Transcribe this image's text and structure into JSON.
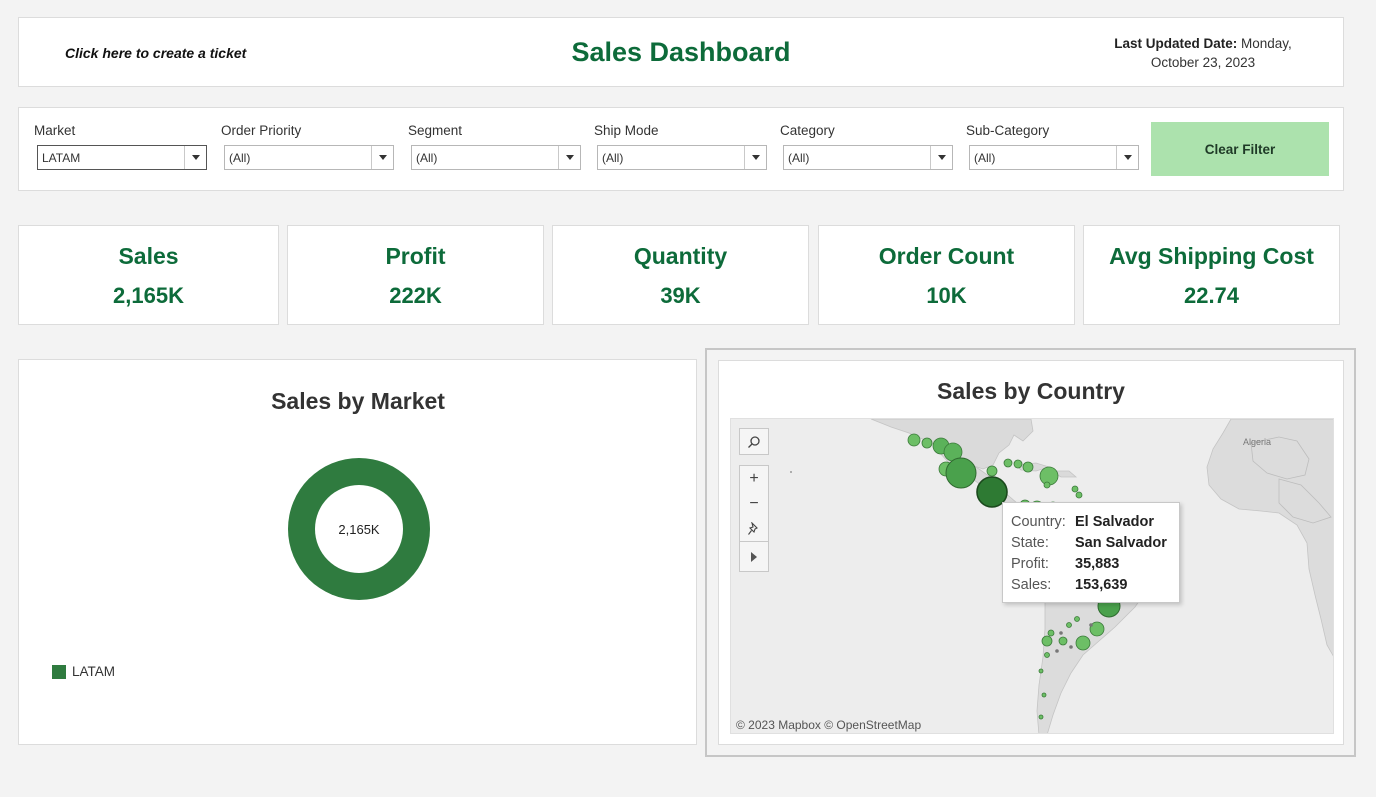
{
  "header": {
    "ticket_link": "Click here to create a ticket",
    "title": "Sales Dashboard",
    "last_updated_label": "Last Updated Date:",
    "last_updated_line1": "Monday,",
    "last_updated_line2": "October 23, 2023"
  },
  "filters": {
    "market": {
      "label": "Market",
      "value": "LATAM"
    },
    "order_priority": {
      "label": "Order Priority",
      "value": "(All)"
    },
    "segment": {
      "label": "Segment",
      "value": "(All)"
    },
    "ship_mode": {
      "label": "Ship Mode",
      "value": "(All)"
    },
    "category": {
      "label": "Category",
      "value": "(All)"
    },
    "sub_category": {
      "label": "Sub-Category",
      "value": "(All)"
    },
    "clear_label": "Clear Filter"
  },
  "kpis": {
    "sales": {
      "label": "Sales",
      "value": "2,165K"
    },
    "profit": {
      "label": "Profit",
      "value": "222K"
    },
    "quantity": {
      "label": "Quantity",
      "value": "39K"
    },
    "order_count": {
      "label": "Order Count",
      "value": "10K"
    },
    "avg_shipping": {
      "label": "Avg Shipping Cost",
      "value": "22.74"
    }
  },
  "market_chart": {
    "title": "Sales by Market",
    "center_label": "2,165K",
    "legend": "LATAM",
    "color": "#2f7b3f"
  },
  "country_chart": {
    "title": "Sales by Country",
    "attribution": "© 2023 Mapbox © OpenStreetMap",
    "map_labels": {
      "algeria": "Algeria"
    },
    "tools": [
      "search-icon",
      "zoom-in-icon",
      "zoom-out-icon",
      "pin-icon",
      "expand-arrow-icon"
    ],
    "tooltip": {
      "country_key": "Country:",
      "country": "El Salvador",
      "state_key": "State:",
      "state": "San Salvador",
      "profit_key": "Profit:",
      "profit": "35,883",
      "sales_key": "Sales:",
      "sales": "153,639"
    }
  },
  "chart_data": {
    "type": "pie",
    "title": "Sales by Market",
    "categories": [
      "LATAM"
    ],
    "values": [
      2165
    ],
    "unit": "K",
    "donut": true,
    "colors": [
      "#2f7b3f"
    ],
    "legend_position": "bottom-left"
  }
}
